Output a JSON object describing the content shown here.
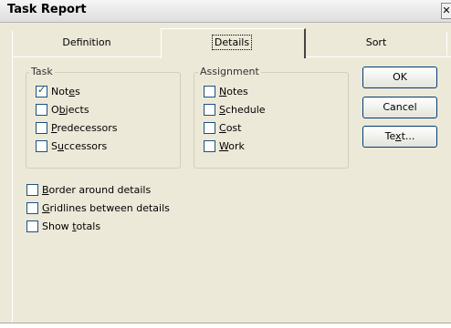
{
  "window": {
    "title": "Task Report",
    "close_glyph": "✕"
  },
  "tabs": [
    {
      "label": "Definition",
      "selected": false
    },
    {
      "label": "Details",
      "selected": true
    },
    {
      "label": "Sort",
      "selected": false
    }
  ],
  "task_group": {
    "title": "Task",
    "items": [
      {
        "pre": "Not",
        "key": "e",
        "post": "s",
        "checked": true
      },
      {
        "pre": "O",
        "key": "b",
        "post": "jects",
        "checked": false
      },
      {
        "pre": "",
        "key": "P",
        "post": "redecessors",
        "checked": false
      },
      {
        "pre": "S",
        "key": "u",
        "post": "ccessors",
        "checked": false
      }
    ]
  },
  "assignment_group": {
    "title": "Assignment",
    "items": [
      {
        "pre": "",
        "key": "N",
        "post": "otes",
        "checked": false
      },
      {
        "pre": "",
        "key": "S",
        "post": "chedule",
        "checked": false
      },
      {
        "pre": "",
        "key": "C",
        "post": "ost",
        "checked": false
      },
      {
        "pre": "",
        "key": "W",
        "post": "ork",
        "checked": false
      }
    ]
  },
  "options": [
    {
      "pre": "",
      "key": "B",
      "post": "order around details",
      "checked": false
    },
    {
      "pre": "",
      "key": "G",
      "post": "ridlines between details",
      "checked": false
    },
    {
      "pre": "Show ",
      "key": "t",
      "post": "otals",
      "checked": false
    }
  ],
  "buttons": {
    "ok": "OK",
    "cancel": "Cancel",
    "text_pre": "Te",
    "text_key": "x",
    "text_post": "t..."
  },
  "colors": {
    "checkmark": "#215e21",
    "window_bg": "#ece9d8",
    "checkbox_border": "#1c5180"
  }
}
